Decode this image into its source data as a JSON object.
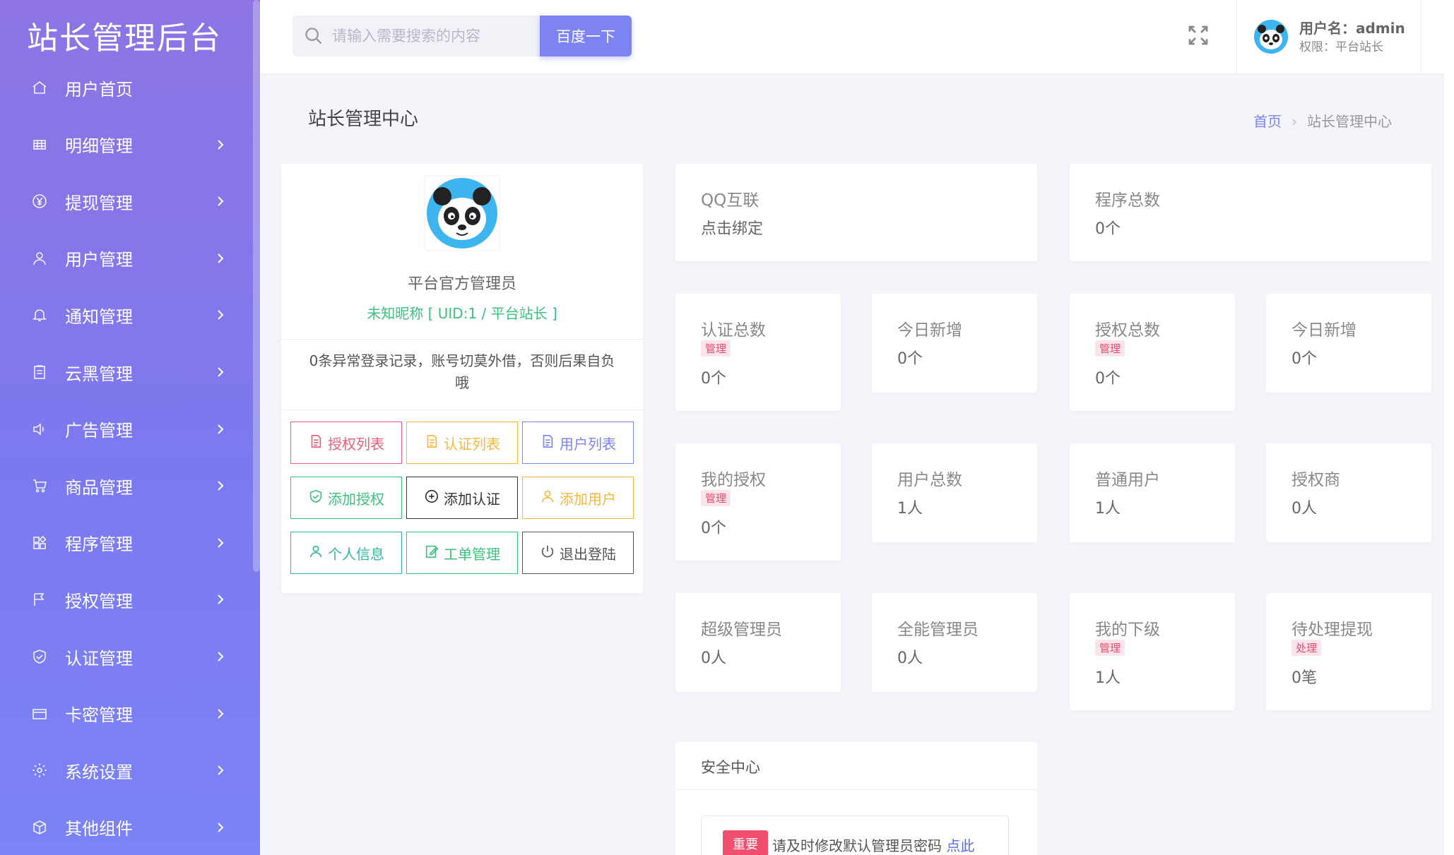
{
  "sidebar": {
    "brand": "站长管理后台",
    "items": [
      {
        "label": "用户首页",
        "icon": "home-icon",
        "arrow": false
      },
      {
        "label": "明细管理",
        "icon": "grid-icon",
        "arrow": true
      },
      {
        "label": "提现管理",
        "icon": "yen-icon",
        "arrow": true
      },
      {
        "label": "用户管理",
        "icon": "user-icon",
        "arrow": true
      },
      {
        "label": "通知管理",
        "icon": "bell-icon",
        "arrow": true
      },
      {
        "label": "云黑管理",
        "icon": "clipboard-icon",
        "arrow": true
      },
      {
        "label": "广告管理",
        "icon": "speaker-icon",
        "arrow": true
      },
      {
        "label": "商品管理",
        "icon": "cart-icon",
        "arrow": true
      },
      {
        "label": "程序管理",
        "icon": "apps-icon",
        "arrow": true
      },
      {
        "label": "授权管理",
        "icon": "flag-icon",
        "arrow": true
      },
      {
        "label": "认证管理",
        "icon": "shield-icon",
        "arrow": true
      },
      {
        "label": "卡密管理",
        "icon": "card-icon",
        "arrow": true
      },
      {
        "label": "系统设置",
        "icon": "gear-icon",
        "arrow": true
      },
      {
        "label": "其他组件",
        "icon": "cube-icon",
        "arrow": true
      }
    ]
  },
  "topbar": {
    "search_placeholder": "请输入需要搜索的内容",
    "search_button": "百度一下",
    "username": "用户名：admin",
    "role": "权限：平台站长"
  },
  "page": {
    "title": "站长管理中心",
    "breadcrumb_home": "首页",
    "breadcrumb_sep": "›",
    "breadcrumb_current": "站长管理中心"
  },
  "profile": {
    "name": "平台官方管理员",
    "nick": "未知昵称 [ UID:1 / 平台站长 ]",
    "notice": "0条异常登录记录，账号切莫外借，否则后果自负哦",
    "buttons": [
      {
        "label": "授权列表",
        "icon": "file-icon",
        "color": "#e8607a"
      },
      {
        "label": "认证列表",
        "icon": "file-icon",
        "color": "#f5b83d"
      },
      {
        "label": "用户列表",
        "icon": "file-icon",
        "color": "#7d83f0"
      },
      {
        "label": "添加授权",
        "icon": "shield-check-icon",
        "color": "#3cc17f"
      },
      {
        "label": "添加认证",
        "icon": "plus-circle-icon",
        "color": "#333333"
      },
      {
        "label": "添加用户",
        "icon": "user-icon",
        "color": "#f5b83d"
      },
      {
        "label": "个人信息",
        "icon": "user-icon",
        "color": "#36b5a2"
      },
      {
        "label": "工单管理",
        "icon": "edit-icon",
        "color": "#3cc17f"
      },
      {
        "label": "退出登陆",
        "icon": "power-icon",
        "color": "#555555"
      }
    ]
  },
  "cards": {
    "qq": {
      "title": "QQ互联",
      "value": "点击绑定"
    },
    "programs": {
      "title": "程序总数",
      "value": "0个"
    },
    "cert_total": {
      "title": "认证总数",
      "badge": "管理",
      "value": "0个"
    },
    "cert_today": {
      "title": "今日新增",
      "value": "0个"
    },
    "auth_total": {
      "title": "授权总数",
      "badge": "管理",
      "value": "0个"
    },
    "auth_today": {
      "title": "今日新增",
      "value": "0个"
    },
    "my_auth": {
      "title": "我的授权",
      "badge": "管理",
      "value": "0个"
    },
    "users_total": {
      "title": "用户总数",
      "value": "1人"
    },
    "normal_users": {
      "title": "普通用户",
      "value": "1人"
    },
    "agents": {
      "title": "授权商",
      "value": "0人"
    },
    "super_admin": {
      "title": "超级管理员",
      "value": "0人"
    },
    "full_admin": {
      "title": "全能管理员",
      "value": "0人"
    },
    "subordinates": {
      "title": "我的下级",
      "badge": "管理",
      "value": "1人"
    },
    "pending_withdraw": {
      "title": "待处理提现",
      "badge": "处理",
      "value": "0笔"
    }
  },
  "security": {
    "title": "安全中心",
    "tag": "重要",
    "text": "请及时修改默认管理员密码",
    "link": "点此"
  },
  "colors": {
    "accent": "#7d83f0",
    "green": "#3cc17f",
    "badge_red": "#e84a6b"
  }
}
